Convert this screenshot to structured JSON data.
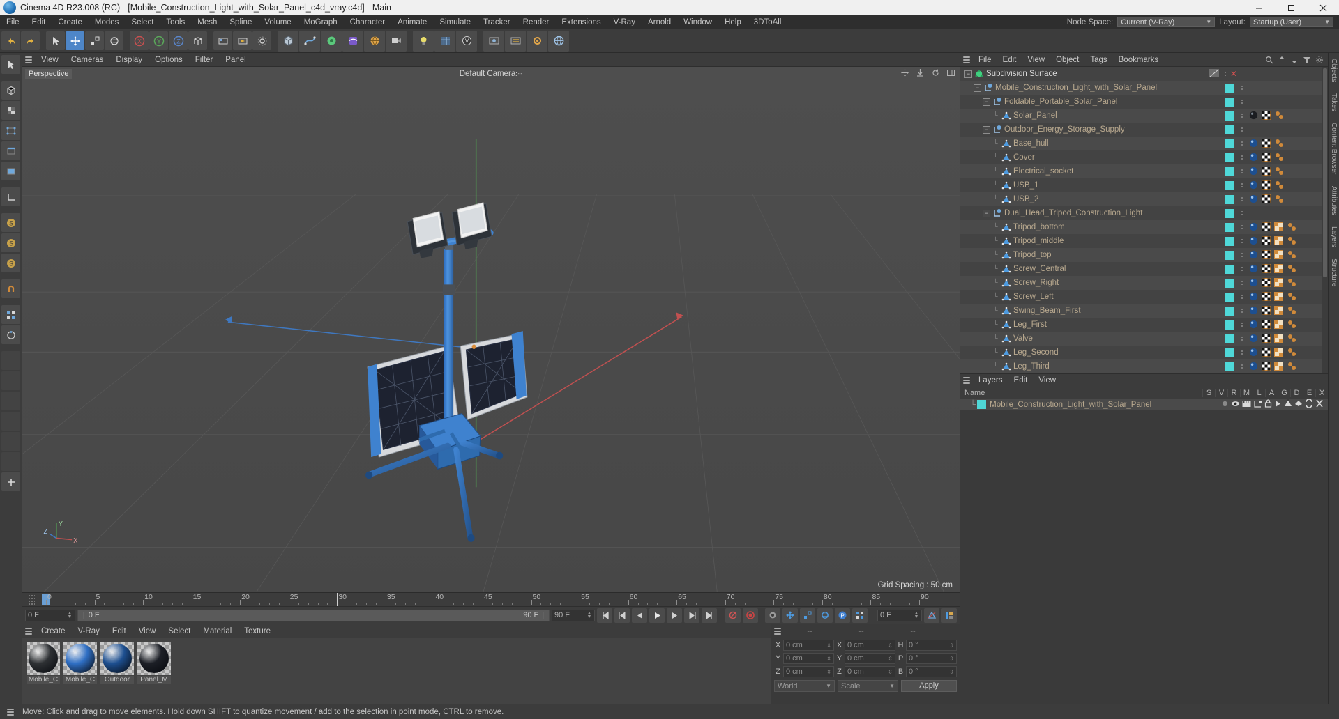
{
  "window": {
    "title": "Cinema 4D R23.008 (RC) - [Mobile_Construction_Light_with_Solar_Panel_c4d_vray.c4d] - Main",
    "minimize": "–",
    "maximize": "▢",
    "close": "✕"
  },
  "menubar": {
    "items": [
      "File",
      "Edit",
      "Create",
      "Modes",
      "Select",
      "Tools",
      "Mesh",
      "Spline",
      "Volume",
      "MoGraph",
      "Character",
      "Animate",
      "Simulate",
      "Tracker",
      "Render",
      "Extensions",
      "V-Ray",
      "Arnold",
      "Window",
      "Help",
      "3DToAll"
    ],
    "node_space_label": "Node Space:",
    "node_space_value": "Current (V-Ray)",
    "layout_label": "Layout:",
    "layout_value": "Startup (User)"
  },
  "viewport": {
    "menu": [
      "View",
      "Cameras",
      "Display",
      "Options",
      "Filter",
      "Panel"
    ],
    "label": "Perspective",
    "camera": "Default Camera",
    "grid_spacing": "Grid Spacing : 50 cm",
    "axis_x": "X",
    "axis_y": "Y",
    "axis_z": "Z"
  },
  "timeline": {
    "ticks": [
      "0",
      "5",
      "10",
      "15",
      "20",
      "25",
      "30",
      "35",
      "40",
      "45",
      "50",
      "55",
      "60",
      "65",
      "70",
      "75",
      "80",
      "85",
      "90"
    ],
    "current_frame": "0 F",
    "current_frame_bar": "0 F",
    "end_frame": "90 F",
    "preview_end": "90 F",
    "right_frame": "0 F"
  },
  "material_manager": {
    "menu": [
      "Create",
      "V-Ray",
      "Edit",
      "View",
      "Select",
      "Material",
      "Texture"
    ],
    "materials": [
      {
        "name": "Mobile_C",
        "color": "#2e3134"
      },
      {
        "name": "Mobile_C",
        "color": "#2f6fc4"
      },
      {
        "name": "Outdoor",
        "color": "#1d4f90"
      },
      {
        "name": "Panel_M",
        "color": "#1c1f26"
      }
    ]
  },
  "coordinates": {
    "header": [
      "--",
      "--",
      "--"
    ],
    "position": [
      {
        "label": "X",
        "value": "0 cm"
      },
      {
        "label": "Y",
        "value": "0 cm"
      },
      {
        "label": "Z",
        "value": "0 cm"
      }
    ],
    "size": [
      {
        "label": "X",
        "value": "0 cm"
      },
      {
        "label": "Y",
        "value": "0 cm"
      },
      {
        "label": "Z",
        "value": "0 cm"
      }
    ],
    "rotation": [
      {
        "label": "H",
        "value": "0 °"
      },
      {
        "label": "P",
        "value": "0 °"
      },
      {
        "label": "B",
        "value": "0 °"
      }
    ],
    "system": "World",
    "mode": "Scale",
    "apply": "Apply"
  },
  "object_manager": {
    "menu": [
      "File",
      "Edit",
      "View",
      "Object",
      "Tags",
      "Bookmarks"
    ],
    "rows": [
      {
        "label": "Subdivision Surface",
        "depth": 0,
        "icon": "subdivision",
        "expand": true,
        "cyan": false,
        "tags": [],
        "special": "root"
      },
      {
        "label": "Mobile_Construction_Light_with_Solar_Panel",
        "depth": 1,
        "icon": "null",
        "expand": true,
        "cyan": true,
        "tags": []
      },
      {
        "label": "Foldable_Portable_Solar_Panel",
        "depth": 2,
        "icon": "null",
        "expand": true,
        "cyan": true,
        "tags": []
      },
      {
        "label": "Solar_Panel",
        "depth": 3,
        "icon": "polygon",
        "expand": false,
        "cyan": true,
        "tags": [
          "mat-dark",
          "uv",
          "point"
        ]
      },
      {
        "label": "Outdoor_Energy_Storage_Supply",
        "depth": 2,
        "icon": "null",
        "expand": true,
        "cyan": true,
        "tags": []
      },
      {
        "label": "Base_hull",
        "depth": 3,
        "icon": "polygon",
        "expand": false,
        "cyan": true,
        "tags": [
          "mat-blue",
          "uv",
          "point"
        ]
      },
      {
        "label": "Cover",
        "depth": 3,
        "icon": "polygon",
        "expand": false,
        "cyan": true,
        "tags": [
          "mat-blue",
          "uv",
          "point"
        ]
      },
      {
        "label": "Electrical_socket",
        "depth": 3,
        "icon": "polygon",
        "expand": false,
        "cyan": true,
        "tags": [
          "mat-blue",
          "uv",
          "point"
        ]
      },
      {
        "label": "USB_1",
        "depth": 3,
        "icon": "polygon",
        "expand": false,
        "cyan": true,
        "tags": [
          "mat-blue",
          "uv",
          "point"
        ]
      },
      {
        "label": "USB_2",
        "depth": 3,
        "icon": "polygon",
        "expand": false,
        "cyan": true,
        "tags": [
          "mat-blue",
          "uv",
          "point"
        ]
      },
      {
        "label": "Dual_Head_Tripod_Construction_Light",
        "depth": 2,
        "icon": "null",
        "expand": true,
        "cyan": true,
        "tags": []
      },
      {
        "label": "Tripod_bottom",
        "depth": 3,
        "icon": "polygon",
        "expand": false,
        "cyan": true,
        "tags": [
          "mat-blue",
          "uv",
          "sel",
          "point"
        ]
      },
      {
        "label": "Tripod_middle",
        "depth": 3,
        "icon": "polygon",
        "expand": false,
        "cyan": true,
        "tags": [
          "mat-blue",
          "uv",
          "sel",
          "point"
        ]
      },
      {
        "label": "Tripod_top",
        "depth": 3,
        "icon": "polygon",
        "expand": false,
        "cyan": true,
        "tags": [
          "mat-blue",
          "uv",
          "sel",
          "point"
        ]
      },
      {
        "label": "Screw_Central",
        "depth": 3,
        "icon": "polygon",
        "expand": false,
        "cyan": true,
        "tags": [
          "mat-blue",
          "uv",
          "sel",
          "point"
        ]
      },
      {
        "label": "Screw_Right",
        "depth": 3,
        "icon": "polygon",
        "expand": false,
        "cyan": true,
        "tags": [
          "mat-blue",
          "uv",
          "sel",
          "point"
        ]
      },
      {
        "label": "Screw_Left",
        "depth": 3,
        "icon": "polygon",
        "expand": false,
        "cyan": true,
        "tags": [
          "mat-blue",
          "uv",
          "sel",
          "point"
        ]
      },
      {
        "label": "Swing_Beam_First",
        "depth": 3,
        "icon": "polygon",
        "expand": false,
        "cyan": true,
        "tags": [
          "mat-blue",
          "uv",
          "sel",
          "point"
        ]
      },
      {
        "label": "Leg_First",
        "depth": 3,
        "icon": "polygon",
        "expand": false,
        "cyan": true,
        "tags": [
          "mat-blue",
          "uv",
          "sel",
          "point"
        ]
      },
      {
        "label": "Valve",
        "depth": 3,
        "icon": "polygon",
        "expand": false,
        "cyan": true,
        "tags": [
          "mat-blue",
          "uv",
          "sel",
          "point"
        ]
      },
      {
        "label": "Leg_Second",
        "depth": 3,
        "icon": "polygon",
        "expand": false,
        "cyan": true,
        "tags": [
          "mat-blue",
          "uv",
          "sel",
          "point"
        ]
      },
      {
        "label": "Leg_Third",
        "depth": 3,
        "icon": "polygon",
        "expand": false,
        "cyan": true,
        "tags": [
          "mat-blue",
          "uv",
          "sel",
          "point"
        ]
      }
    ]
  },
  "layer_manager": {
    "menu": [
      "Layers",
      "Edit",
      "View"
    ],
    "name_header": "Name",
    "columns": [
      "S",
      "V",
      "R",
      "M",
      "L",
      "A",
      "G",
      "D",
      "E",
      "X"
    ],
    "rows": [
      {
        "name": "Mobile_Construction_Light_with_Solar_Panel",
        "color": "#4fd8d8"
      }
    ]
  },
  "right_tabs": [
    "Objects",
    "Takes",
    "Content Browser",
    "Attributes",
    "Layers",
    "Structure"
  ],
  "statusbar": {
    "text": "Move: Click and drag to move elements. Hold down SHIFT to quantize movement / add to the selection in point mode, CTRL to remove."
  },
  "colors": {
    "cyan": "#4fd8d8",
    "accent_blue": "#5a93d4",
    "x_axis": "#c0504d",
    "y_axis": "#4f9b4f",
    "z_axis": "#4a7fc1"
  }
}
